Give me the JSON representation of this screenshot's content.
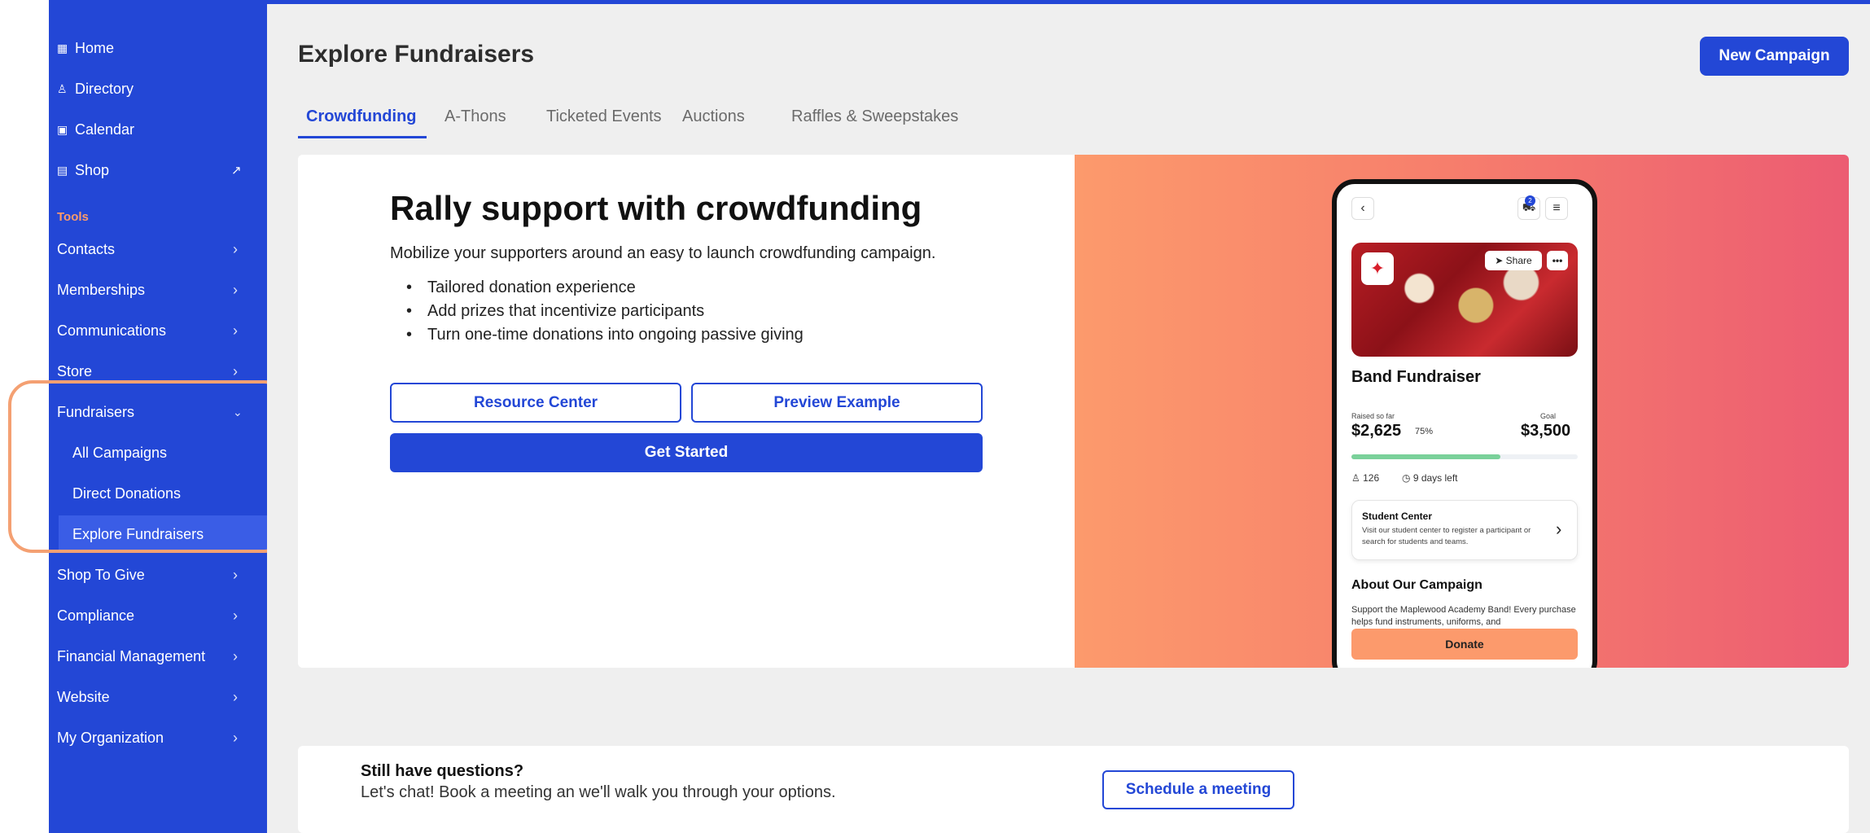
{
  "sidebar": {
    "top_items": [
      {
        "label": "Home",
        "icon": "home-icon"
      },
      {
        "label": "Directory",
        "icon": "people-icon"
      },
      {
        "label": "Calendar",
        "icon": "calendar-icon"
      },
      {
        "label": "Shop",
        "icon": "shop-icon"
      }
    ],
    "tools_label": "Tools",
    "tools_items": [
      {
        "label": "Contacts"
      },
      {
        "label": "Memberships"
      },
      {
        "label": "Communications"
      },
      {
        "label": "Store"
      },
      {
        "label": "Fundraisers"
      }
    ],
    "fundraiser_subitems": [
      {
        "label": "All Campaigns"
      },
      {
        "label": "Direct Donations"
      },
      {
        "label": "Explore Fundraisers"
      }
    ],
    "more_items": [
      {
        "label": "Shop To Give"
      },
      {
        "label": "Compliance"
      },
      {
        "label": "Financial Management"
      },
      {
        "label": "Website"
      },
      {
        "label": "My Organization"
      }
    ]
  },
  "header": {
    "title": "Explore Fundraisers",
    "new_campaign_label": "New Campaign"
  },
  "tabs": [
    {
      "label": "Crowdfunding",
      "active": true
    },
    {
      "label": "A-Thons"
    },
    {
      "label": "Ticketed Events"
    },
    {
      "label": "Auctions"
    },
    {
      "label": "Raffles & Sweepstakes"
    }
  ],
  "hero": {
    "title": "Rally support with crowdfunding",
    "subtitle": "Mobilize your supporters around an easy to launch crowdfunding campaign.",
    "bullets": [
      "Tailored donation experience",
      "Add prizes that incentivize participants",
      "Turn one-time donations into ongoing passive giving"
    ],
    "resource_center_label": "Resource Center",
    "preview_example_label": "Preview Example",
    "get_started_label": "Get Started"
  },
  "phone_preview": {
    "cart_count": "2",
    "share_label": "Share",
    "campaign_title": "Band Fundraiser",
    "raised_label": "Raised so far",
    "raised_amount": "$2,625",
    "percent_label": "75%",
    "progress_fraction": 0.66,
    "goal_label": "Goal",
    "goal_amount": "$3,500",
    "supporters_count": "126",
    "days_left": "9 days left",
    "student_center_title": "Student Center",
    "student_center_text": "Visit our student center to register a participant or search for students and teams.",
    "about_title": "About Our Campaign",
    "about_text": "Support the Maplewood Academy Band! Every purchase helps fund instruments, uniforms, and",
    "donate_label": "Donate"
  },
  "questions": {
    "title": "Still have questions?",
    "text": "Let's chat!  Book a meeting an we'll walk you through your options.",
    "schedule_label": "Schedule a meeting"
  },
  "colors": {
    "brand_blue": "#2347d6",
    "accent_orange": "#fc9a6c",
    "highlight_ring": "#f4a072"
  }
}
